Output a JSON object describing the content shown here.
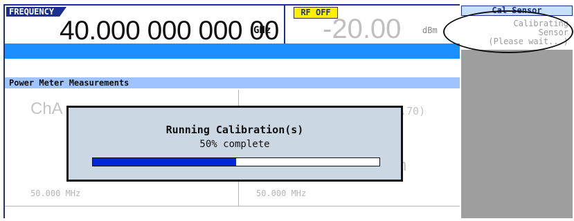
{
  "frequency": {
    "label": "FREQUENCY",
    "value": "40.000 000 000 00",
    "unit": "GHz"
  },
  "amplitude": {
    "rf_status": "RF OFF",
    "value": "-20.00",
    "unit": "dBm"
  },
  "power_meter": {
    "header": "Power Meter Measurements",
    "channel_a": {
      "label": "ChA",
      "frequency": "50.000 MHz"
    },
    "channel_b": {
      "offset_partial": ".70)",
      "reading_partial": "n",
      "frequency": "50.000 MHz"
    }
  },
  "softkey_panel": {
    "title": "Cal Sensor",
    "status_line1": "Calibrating",
    "status_line2": "Sensor",
    "status_line3": "(Please wait...)"
  },
  "dialog": {
    "title": "Running Calibration(s)",
    "percent_text": "50% complete",
    "progress": 0.5
  },
  "colors": {
    "accent_blue": "#1a2f8f",
    "bar_blue": "#1a8fff",
    "header_blue": "#9ec3ff",
    "rf_off_yellow": "#fff000",
    "progress_fill": "#0027d6"
  }
}
